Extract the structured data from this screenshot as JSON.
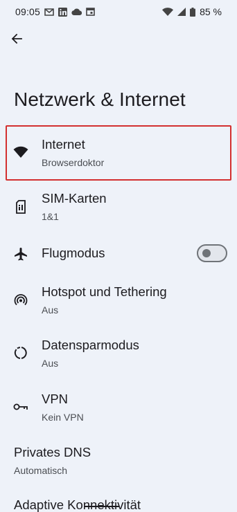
{
  "status_bar": {
    "time": "09:05",
    "battery_text": "85 %"
  },
  "page": {
    "title": "Netzwerk & Internet"
  },
  "items": [
    {
      "title": "Internet",
      "subtitle": "Browserdoktor",
      "icon": "wifi-icon"
    },
    {
      "title": "SIM-Karten",
      "subtitle": "1&1",
      "icon": "sim-card-icon"
    },
    {
      "title": "Flugmodus",
      "subtitle": "",
      "icon": "airplane-icon",
      "toggle_on": false
    },
    {
      "title": "Hotspot und Tethering",
      "subtitle": "Aus",
      "icon": "hotspot-icon"
    },
    {
      "title": "Datensparmodus",
      "subtitle": "Aus",
      "icon": "data-saver-icon"
    },
    {
      "title": "VPN",
      "subtitle": "Kein VPN",
      "icon": "vpn-key-icon"
    },
    {
      "title": "Privates DNS",
      "subtitle": "Automatisch"
    },
    {
      "title": "Adaptive Konnektivität",
      "subtitle": ""
    }
  ],
  "colors": {
    "background": "#eef2f9",
    "highlight_border": "#d32f2f"
  }
}
